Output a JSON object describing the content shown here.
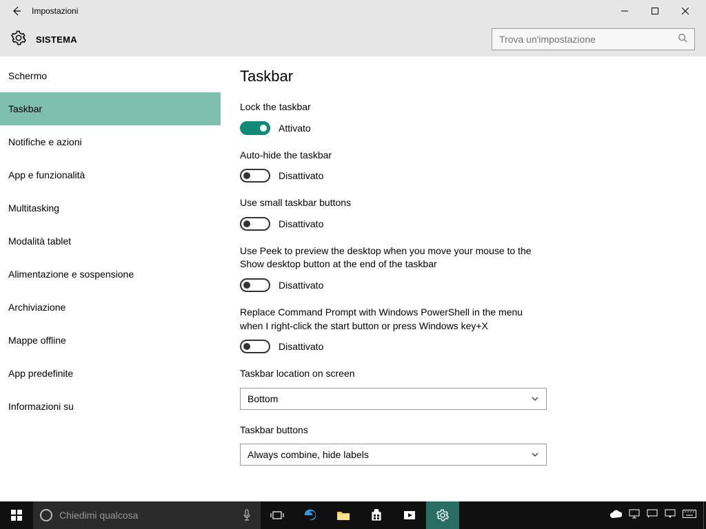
{
  "titlebar": {
    "title": "Impostazioni"
  },
  "header": {
    "section": "SISTEMA",
    "search_placeholder": "Trova un'impostazione"
  },
  "sidebar": {
    "items": [
      {
        "label": "Schermo"
      },
      {
        "label": "Taskbar"
      },
      {
        "label": "Notifiche e azioni"
      },
      {
        "label": "App e funzionalità"
      },
      {
        "label": "Multitasking"
      },
      {
        "label": "Modalità tablet"
      },
      {
        "label": "Alimentazione e sospensione"
      },
      {
        "label": "Archiviazione"
      },
      {
        "label": "Mappe offline"
      },
      {
        "label": "App predefinite"
      },
      {
        "label": "Informazioni su"
      }
    ],
    "active_index": 1
  },
  "main": {
    "heading": "Taskbar",
    "settings": {
      "lock": {
        "label": "Lock the taskbar",
        "on": true,
        "state": "Attivato"
      },
      "autohide": {
        "label": "Auto-hide the taskbar",
        "on": false,
        "state": "Disattivato"
      },
      "smallbuttons": {
        "label": "Use small taskbar buttons",
        "on": false,
        "state": "Disattivato"
      },
      "peek": {
        "label": "Use Peek to preview the desktop when you move your mouse to the Show desktop button at the end of the taskbar",
        "on": false,
        "state": "Disattivato"
      },
      "powershell": {
        "label": "Replace Command Prompt with Windows PowerShell in the menu when I right-click the start button or press Windows key+X",
        "on": false,
        "state": "Disattivato"
      },
      "location": {
        "label": "Taskbar location on screen",
        "value": "Bottom"
      },
      "buttons": {
        "label": "Taskbar buttons",
        "value": "Always combine, hide labels"
      }
    }
  },
  "taskbar": {
    "cortana_placeholder": "Chiedimi qualcosa"
  }
}
